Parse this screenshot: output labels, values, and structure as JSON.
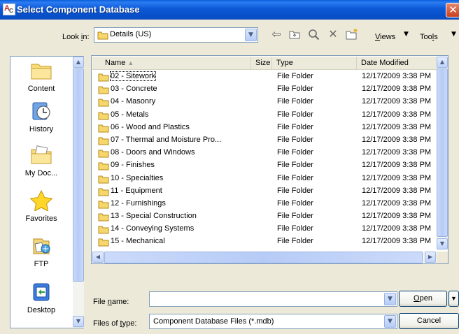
{
  "window": {
    "title": "Select Component Database"
  },
  "lookin": {
    "label_prefix": "Look ",
    "label_key": "i",
    "label_suffix": "n:",
    "value": "Details (US)"
  },
  "toolbar": {
    "views_key": "V",
    "views_rest": "iews",
    "tools_prefix": "Too",
    "tools_key": "l",
    "tools_suffix": "s"
  },
  "places": [
    {
      "label": "Content",
      "icon": "folder-icon"
    },
    {
      "label": "History",
      "icon": "history-icon"
    },
    {
      "label": "My Doc...",
      "icon": "my-documents-icon"
    },
    {
      "label": "Favorites",
      "icon": "favorites-star-icon"
    },
    {
      "label": "FTP",
      "icon": "ftp-icon"
    },
    {
      "label": "Desktop",
      "icon": "desktop-icon"
    }
  ],
  "columns": {
    "name": "Name",
    "size": "Size",
    "type": "Type",
    "date": "Date Modified"
  },
  "files": [
    {
      "name": "02 - Sitework",
      "type": "File Folder",
      "date": "12/17/2009 3:38 PM"
    },
    {
      "name": "03 - Concrete",
      "type": "File Folder",
      "date": "12/17/2009 3:38 PM"
    },
    {
      "name": "04 - Masonry",
      "type": "File Folder",
      "date": "12/17/2009 3:38 PM"
    },
    {
      "name": "05 - Metals",
      "type": "File Folder",
      "date": "12/17/2009 3:38 PM"
    },
    {
      "name": "06 - Wood and Plastics",
      "type": "File Folder",
      "date": "12/17/2009 3:38 PM"
    },
    {
      "name": "07 - Thermal and Moisture Pro...",
      "type": "File Folder",
      "date": "12/17/2009 3:38 PM"
    },
    {
      "name": "08 - Doors and Windows",
      "type": "File Folder",
      "date": "12/17/2009 3:38 PM"
    },
    {
      "name": "09 - Finishes",
      "type": "File Folder",
      "date": "12/17/2009 3:38 PM"
    },
    {
      "name": "10 - Specialties",
      "type": "File Folder",
      "date": "12/17/2009 3:38 PM"
    },
    {
      "name": "11 - Equipment",
      "type": "File Folder",
      "date": "12/17/2009 3:38 PM"
    },
    {
      "name": "12 - Furnishings",
      "type": "File Folder",
      "date": "12/17/2009 3:38 PM"
    },
    {
      "name": "13 - Special Construction",
      "type": "File Folder",
      "date": "12/17/2009 3:38 PM"
    },
    {
      "name": "14 - Conveying Systems",
      "type": "File Folder",
      "date": "12/17/2009 3:38 PM"
    },
    {
      "name": "15 - Mechanical",
      "type": "File Folder",
      "date": "12/17/2009 3:38 PM"
    }
  ],
  "filename": {
    "label_prefix": "File ",
    "label_key": "n",
    "label_suffix": "ame:",
    "value": ""
  },
  "filetype": {
    "label_prefix": "Files of ",
    "label_key": "t",
    "label_suffix": "ype:",
    "value": "Component Database Files (*.mdb)"
  },
  "buttons": {
    "open_key": "O",
    "open_rest": "pen",
    "cancel": "Cancel"
  }
}
